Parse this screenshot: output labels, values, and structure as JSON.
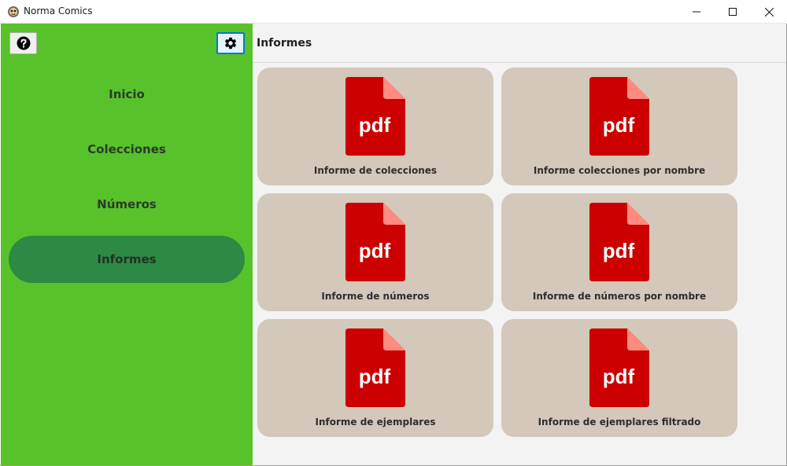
{
  "window": {
    "title": "Norma Comics",
    "controls": [
      "minimize-icon",
      "maximize-icon",
      "close-icon"
    ]
  },
  "sidebar": {
    "help_icon": "question-circle-icon",
    "settings_icon": "gear-icon",
    "items": [
      {
        "label": "Inicio",
        "active": false
      },
      {
        "label": "Colecciones",
        "active": false
      },
      {
        "label": "Números",
        "active": false
      },
      {
        "label": "Informes",
        "active": true
      }
    ]
  },
  "main": {
    "title": "Informes",
    "icon_text": "pdf",
    "cards": [
      {
        "label": "Informe de colecciones"
      },
      {
        "label": "Informe colecciones por nombre"
      },
      {
        "label": "Informe de números"
      },
      {
        "label": "Informe de números por nombre"
      },
      {
        "label": "Informe de ejemplares"
      },
      {
        "label": "Informe de ejemplares filtrado"
      }
    ]
  },
  "colors": {
    "sidebar": "#58c22a",
    "active_nav": "#2c8a45",
    "card": "#d3c8b9",
    "pdf_red": "#cc0000",
    "pdf_fold": "#ff8a80"
  }
}
